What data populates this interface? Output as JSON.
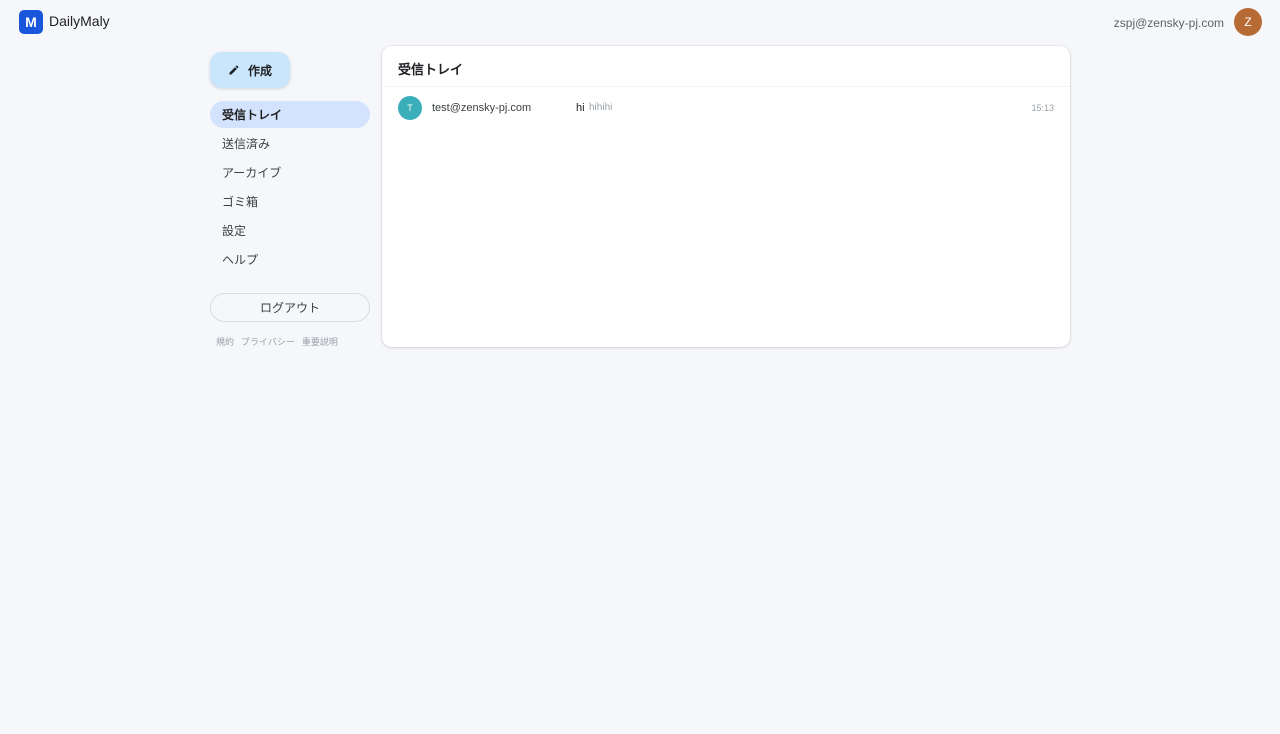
{
  "header": {
    "logo_letter": "M",
    "app_name": "DailyMaly",
    "user_email": "zspj@zensky-pj.com",
    "avatar_letter": "Z"
  },
  "sidebar": {
    "compose_label": "作成",
    "items": [
      {
        "label": "受信トレイ",
        "active": true
      },
      {
        "label": "送信済み",
        "active": false
      },
      {
        "label": "アーカイブ",
        "active": false
      },
      {
        "label": "ゴミ箱",
        "active": false
      },
      {
        "label": "設定",
        "active": false
      },
      {
        "label": "ヘルプ",
        "active": false
      }
    ],
    "logout_label": "ログアウト",
    "footer_links": [
      "規約",
      "プライバシー",
      "重要説明"
    ]
  },
  "main": {
    "title": "受信トレイ",
    "messages": [
      {
        "avatar_letter": "T",
        "sender": "test@zensky-pj.com",
        "subject": "hi",
        "snippet": "hihihi",
        "time": "15:13"
      }
    ]
  },
  "colors": {
    "background": "#f6f7fb",
    "brand": "#1a56db",
    "compose_bg": "#c9e6fc",
    "active_nav_bg": "#d3e3fd",
    "user_avatar": "#b86a35",
    "sender_avatar": "#3aafb9"
  },
  "icons": {
    "compose": "pencil-icon"
  }
}
